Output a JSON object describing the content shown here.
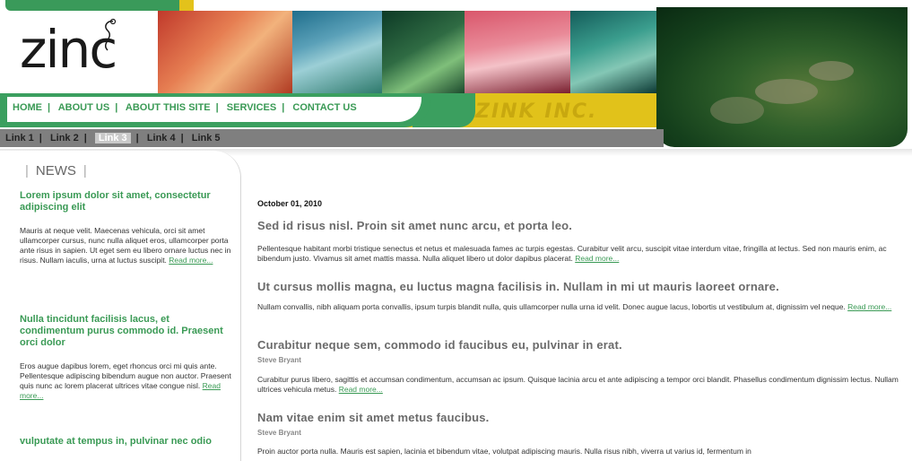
{
  "logo": {
    "text": "zinc"
  },
  "brand": "ZINK INC.",
  "main_nav": [
    {
      "label": "HOME",
      "active": true
    },
    {
      "label": "ABOUT US"
    },
    {
      "label": "ABOUT THIS SITE"
    },
    {
      "label": "SERVICES"
    },
    {
      "label": "CONTACT US"
    }
  ],
  "sub_nav": [
    {
      "label": "Link 1"
    },
    {
      "label": "Link 2"
    },
    {
      "label": "Link 3",
      "active": true
    },
    {
      "label": "Link 4"
    },
    {
      "label": "Link 5"
    }
  ],
  "sidebar": {
    "title": "NEWS",
    "items": [
      {
        "heading": "Lorem ipsum dolor sit amet, consectetur adipiscing elit",
        "body": "Mauris at neque velit. Maecenas vehicula, orci sit amet ullamcorper cursus, nunc nulla aliquet eros, ullamcorper porta ante risus in sapien. Ut eget sem eu libero ornare luctus nec in risus. Nullam iaculis, urna at luctus suscipit.",
        "more": "Read more..."
      },
      {
        "heading": "Nulla tincidunt facilisis lacus, et condimentum purus commodo id. Praesent orci dolor",
        "body": "Eros augue dapibus lorem, eget rhoncus orci mi quis ante. Pellentesque adipiscing bibendum augue non auctor. Praesent quis nunc ac lorem placerat ultrices vitae congue nisl.",
        "more": "Read more..."
      },
      {
        "heading": "vulputate at tempus in, pulvinar nec odio",
        "body": "",
        "more": ""
      }
    ]
  },
  "content": {
    "date": "October 01, 2010",
    "articles": [
      {
        "title": "Sed id risus nisl. Proin sit amet nunc arcu, et porta leo.",
        "author": "",
        "body": "Pellentesque habitant morbi tristique senectus et netus et malesuada fames ac turpis egestas. Curabitur velit arcu, suscipit vitae interdum vitae, fringilla at lectus. Sed non mauris enim, ac bibendum justo. Vivamus sit amet mattis massa. Nulla aliquet libero ut dolor dapibus placerat.",
        "more": "Read more..."
      },
      {
        "title": "Ut cursus mollis magna, eu luctus magna facilisis in. Nullam in mi ut mauris laoreet ornare.",
        "author": "",
        "body": "Nullam convallis, nibh aliquam porta convallis, ipsum turpis blandit nulla, quis ullamcorper nulla urna id velit. Donec augue lacus, lobortis ut vestibulum at, dignissim vel neque.",
        "more": "Read more..."
      },
      {
        "title": "Curabitur neque sem, commodo id faucibus eu, pulvinar in erat.",
        "author": "Steve Bryant",
        "body": "Curabitur purus libero, sagittis et accumsan condimentum, accumsan ac ipsum. Quisque lacinia arcu et ante adipiscing a tempor orci blandit. Phasellus condimentum dignissim lectus. Nullam ultrices vehicula metus.",
        "more": "Read more..."
      },
      {
        "title": "Nam vitae enim sit amet metus faucibus.",
        "author": "Steve Bryant",
        "body": "Proin auctor porta nulla. Mauris est sapien, lacinia et bibendum vitae, volutpat adipiscing mauris. Nulla risus nibh, viverra ut varius id, fermentum in",
        "more": ""
      }
    ]
  },
  "colors": {
    "green": "#3a9a55",
    "yellow": "#e1c21a",
    "gray": "#7f7f7f"
  }
}
